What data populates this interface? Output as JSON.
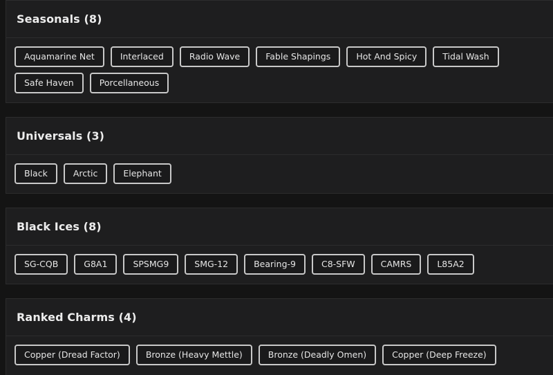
{
  "sections": [
    {
      "title": "Seasonals (8)",
      "rows": [
        [
          "Aquamarine Net",
          "Interlaced",
          "Radio Wave",
          "Fable Shapings",
          "Hot And Spicy",
          "Tidal Wash"
        ],
        [
          "Safe Haven",
          "Porcellaneous"
        ]
      ]
    },
    {
      "title": "Universals (3)",
      "rows": [
        [
          "Black",
          "Arctic",
          "Elephant"
        ]
      ]
    },
    {
      "title": "Black Ices (8)",
      "rows": [
        [
          "SG-CQB",
          "G8A1",
          "SPSMG9",
          "SMG-12",
          "Bearing-9",
          "C8-SFW",
          "CAMRS",
          "L85A2"
        ]
      ]
    },
    {
      "title": "Ranked Charms (4)",
      "rows": [
        [
          "Copper (Dread Factor)",
          "Bronze (Heavy Mettle)",
          "Bronze (Deadly Omen)",
          "Copper (Deep Freeze)"
        ]
      ]
    }
  ]
}
